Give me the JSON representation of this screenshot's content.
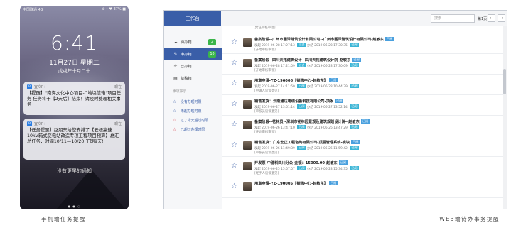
{
  "phone": {
    "carrier": "中国联通 4G",
    "status_right": "⊕ ⌖ ♥ 37% ■",
    "time": "6:41",
    "date": "11月27日 星期二",
    "lunar": "戊戌年十月二十",
    "notifications": [
      {
        "app": "宜众P+",
        "when": "现在",
        "body": "【提醒】\"南海文化中心项目-C地块信箱\"项目任务 任务将于【2天后】结束！请及时处理相关事务"
      },
      {
        "app": "宜众P+",
        "when": "现在",
        "body": "【任务提醒】赵朋东给您安排了【云梧高速10kV箱式变电站改造专项工程项目预算】总汇总任务，时间10/11—10/20,工期9天!"
      }
    ],
    "no_more": "没有更早的通知",
    "page_dots": "● ● ○"
  },
  "captions": {
    "left": "手机端任务提醒",
    "right": "WEB端待办事务提醒"
  },
  "web": {
    "brand": "工作台",
    "search_placeholder": "搜索",
    "page_indicator": "第1页",
    "prev": "←",
    "next": "→",
    "sidebar": [
      {
        "icon": "☁",
        "label": "待办箱",
        "badge": "2",
        "active": false
      },
      {
        "icon": "✎",
        "label": "申办箱",
        "badge": "10",
        "active": true
      },
      {
        "icon": "✈",
        "label": "已办箱",
        "badge": "",
        "active": false
      },
      {
        "icon": "▤",
        "label": "草稿箱",
        "badge": "",
        "active": false
      }
    ],
    "section_label": "事项筛示",
    "filters": [
      {
        "label": "没有办理时限",
        "color": "blue"
      },
      {
        "label": "未超办理时限",
        "color": "blue"
      },
      {
        "label": "过了今天超过时限",
        "color": "red"
      },
      {
        "label": "已超过办理时限",
        "color": "red"
      }
    ],
    "first_partial": "[党证审核审批]",
    "rows": [
      {
        "title": "备案阶段--广州市图泽建筑设计有限公司--广州市图泽建筑设计有限公司-赵敏东",
        "tag": "已阅",
        "meta": "发起 2019-06-28 17:27:13 ",
        "meta_tag": "过去",
        "meta2": " 办结 2019-06-28 17:30:35 ",
        "meta_tag2": "已阅",
        "sub": "[开始审核审批]"
      },
      {
        "title": "备案阶段--四川天拓建筑设计--四川天拓建筑设计院-赵敏东",
        "tag": "已阅",
        "meta": "发起 2019-06-28 17:21:09 ",
        "meta_tag": "过去",
        "meta2": " 办结 2019-06-28 17:30:09 ",
        "meta_tag2": "已阅",
        "sub": "[开始审核审批]"
      },
      {
        "title": "用章申请-YZ-190006【销售中心-赵敏东】",
        "tag": "已阅",
        "meta": "发起 2019-06-27 14:11:50 ",
        "meta_tag": "已阅",
        "meta2": " 办结 2019-06-28 10:44:39 ",
        "meta_tag2": "已阅",
        "sub": "[申请人谈谈意见]"
      },
      {
        "title": "销售发货：云南通达电缆设备科技有限公司-顶板",
        "tag": "已阅",
        "meta": "发起 2019-06-27 13:51:14 ",
        "meta_tag": "已阅",
        "meta2": " 办结 2019-06-27 13:52:14 ",
        "meta_tag2": "已阅",
        "sub": "[审核员谈谈意见]"
      },
      {
        "title": "备案阶段--花林员--深圳市花林园景观及建筑规划设计院--赵敏东",
        "tag": "已阅",
        "meta": "发起 2019-06-26 13:47:10 ",
        "meta_tag": "已阅",
        "meta2": " 办结 2019-06-26 13:47:29 ",
        "meta_tag2": "已阅",
        "sub": "[开始审核审批]"
      },
      {
        "title": "销售发货：广东宏正工程咨询有限公司-顶层管理系统-模块",
        "tag": "已阅",
        "meta": "发起 2019-06-26 11:49:39 ",
        "meta_tag": "已阅",
        "meta2": " 办结 2019-06-26 11:59:42 ",
        "meta_tag2": "已阅",
        "sub": "[审核员谈谈意见]"
      },
      {
        "title": "开发票-中建科四川分公-金额：15000.00-赵敏东",
        "tag": "已阅",
        "meta": "发起 2019-06-25 15:57:07 ",
        "meta_tag": "已阅",
        "meta2": " 办结 2019-06-28 15:34:35 ",
        "meta_tag2": "已阅",
        "sub": "[经手人谈谈意见]"
      },
      {
        "title": "用章申请-YZ-190005【销售中心-赵敏东】",
        "tag": "已阅",
        "meta": "",
        "meta_tag": "",
        "meta2": "",
        "meta_tag2": "",
        "sub": ""
      }
    ]
  }
}
